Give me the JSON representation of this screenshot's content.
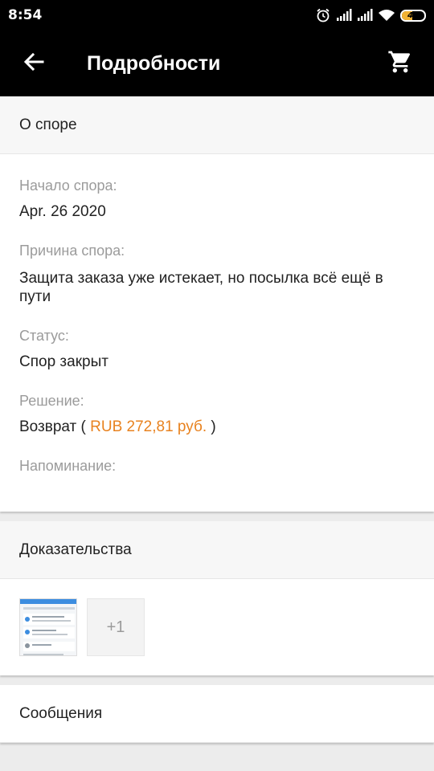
{
  "status_bar": {
    "time": "8:54",
    "battery": "47",
    "icons": [
      "alarm-icon",
      "signal-icon",
      "signal-icon",
      "wifi-icon",
      "battery-icon"
    ]
  },
  "app_bar": {
    "title": "Подробности",
    "back_icon": "arrow-left-icon",
    "cart_icon": "shopping-cart-icon"
  },
  "dispute": {
    "header": "О споре",
    "start_label": "Начало спора:",
    "start_value": "Apr. 26 2020",
    "reason_label": "Причина спора:",
    "reason_value": "Защита заказа уже истекает, но посылка всё ещё в пути",
    "status_label": "Статус:",
    "status_value": "Спор закрыт",
    "resolution_label": "Решение:",
    "resolution_prefix": "Возврат ( ",
    "resolution_amount": "RUB 272,81 руб.",
    "resolution_suffix": " )",
    "reminder_label": "Напоминание:",
    "accent_color": "#e8821f"
  },
  "evidence": {
    "header": "Доказательства",
    "more_count": "+1"
  },
  "messages": {
    "header": "Сообщения"
  }
}
